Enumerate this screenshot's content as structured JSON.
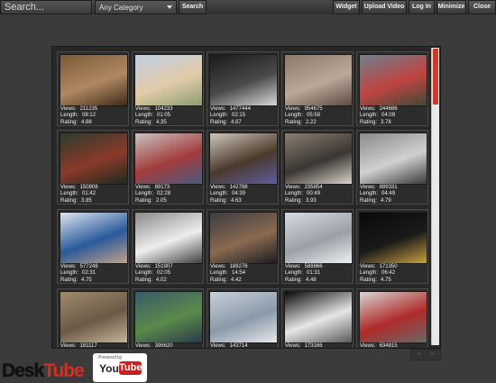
{
  "header": {
    "search_placeholder": "Search...",
    "category_value": "Any Category",
    "search_button": "Search",
    "window_buttons": [
      "Widget",
      "Upload Video",
      "Log In",
      "Minimize",
      "Close"
    ]
  },
  "labels": {
    "views": "Views:",
    "length": "Length:",
    "rating": "Rating:"
  },
  "videos": [
    {
      "views": "211235",
      "length": "08:12",
      "rating": "4.88",
      "colors": [
        "#7a5a38",
        "#b08860",
        "#3e2c1c"
      ]
    },
    {
      "views": "104233",
      "length": "01:05",
      "rating": "4.35",
      "colors": [
        "#c0cfe2",
        "#e1cba8",
        "#8c9d72"
      ]
    },
    {
      "views": "1477444",
      "length": "02:15",
      "rating": "4.87",
      "colors": [
        "#1a1a1a",
        "#4a4a4a",
        "#d8d8d8"
      ]
    },
    {
      "views": "954675",
      "length": "05:58",
      "rating": "2.22",
      "colors": [
        "#8a7868",
        "#bba898",
        "#5c4c42"
      ]
    },
    {
      "views": "244686",
      "length": "04:09",
      "rating": "3.78",
      "colors": [
        "#6f7f8e",
        "#c04440",
        "#3e4a3a"
      ]
    },
    {
      "views": "150808",
      "length": "01:42",
      "rating": "3.85",
      "colors": [
        "#2c3c2c",
        "#8a3a2a",
        "#1e2a1e"
      ]
    },
    {
      "views": "89173",
      "length": "02:28",
      "rating": "2.05",
      "colors": [
        "#c9c3c0",
        "#a33c3c",
        "#4a5a80"
      ]
    },
    {
      "views": "142788",
      "length": "04:39",
      "rating": "4.63",
      "colors": [
        "#cfc7bb",
        "#4a3a2c",
        "#5c5ca0"
      ]
    },
    {
      "views": "235854",
      "length": "00:49",
      "rating": "3.93",
      "colors": [
        "#8a7e72",
        "#3a3631",
        "#d9d3c9"
      ]
    },
    {
      "views": "899331",
      "length": "04:49",
      "rating": "4.79",
      "colors": [
        "#8a8a8a",
        "#d0d0d0",
        "#3a3a3a"
      ]
    },
    {
      "views": "577248",
      "length": "02:31",
      "rating": "4.75",
      "colors": [
        "#dfe6ee",
        "#2a5a9a",
        "#c4a28a"
      ]
    },
    {
      "views": "151907",
      "length": "02:05",
      "rating": "4.02",
      "colors": [
        "#8a8a8a",
        "#eeeeee",
        "#404040"
      ]
    },
    {
      "views": "188276",
      "length": "14:54",
      "rating": "4.42",
      "colors": [
        "#3c3c40",
        "#8a6a50",
        "#1c1c22"
      ]
    },
    {
      "views": "588866",
      "length": "01:31",
      "rating": "4.48",
      "colors": [
        "#d6dce0",
        "#9aa0a6",
        "#eef0f2"
      ]
    },
    {
      "views": "171350",
      "length": "06:42",
      "rating": "4.75",
      "colors": [
        "#0a0a0a",
        "#1a1a1a",
        "#c8a040"
      ]
    },
    {
      "views": "181117",
      "length": "",
      "rating": "",
      "colors": [
        "#a08a6e",
        "#6a5a46",
        "#c6b49a"
      ]
    },
    {
      "views": "396620",
      "length": "",
      "rating": "",
      "colors": [
        "#3a5a6a",
        "#5a8a4a",
        "#2a3a4a"
      ]
    },
    {
      "views": "143714",
      "length": "",
      "rating": "",
      "colors": [
        "#c8d0d8",
        "#8a9aaa",
        "#e8e8e8"
      ]
    },
    {
      "views": "173166",
      "length": "",
      "rating": "",
      "colors": [
        "#0a0a0a",
        "#e6e6e6",
        "#5a5a5a"
      ]
    },
    {
      "views": "634815",
      "length": "",
      "rating": "",
      "colors": [
        "#d8d6d4",
        "#b02a2a",
        "#6a6a6a"
      ]
    }
  ],
  "pager": {
    "prev": "<",
    "next": ">"
  },
  "brand": {
    "desk": "Desk",
    "tube": "Tube",
    "powered_by": "Powered by",
    "you": "You",
    "tube_badge": "Tube"
  },
  "colors": {
    "accent": "#cc3a2c",
    "background": "#3b3b3b",
    "panel": "#272727"
  }
}
